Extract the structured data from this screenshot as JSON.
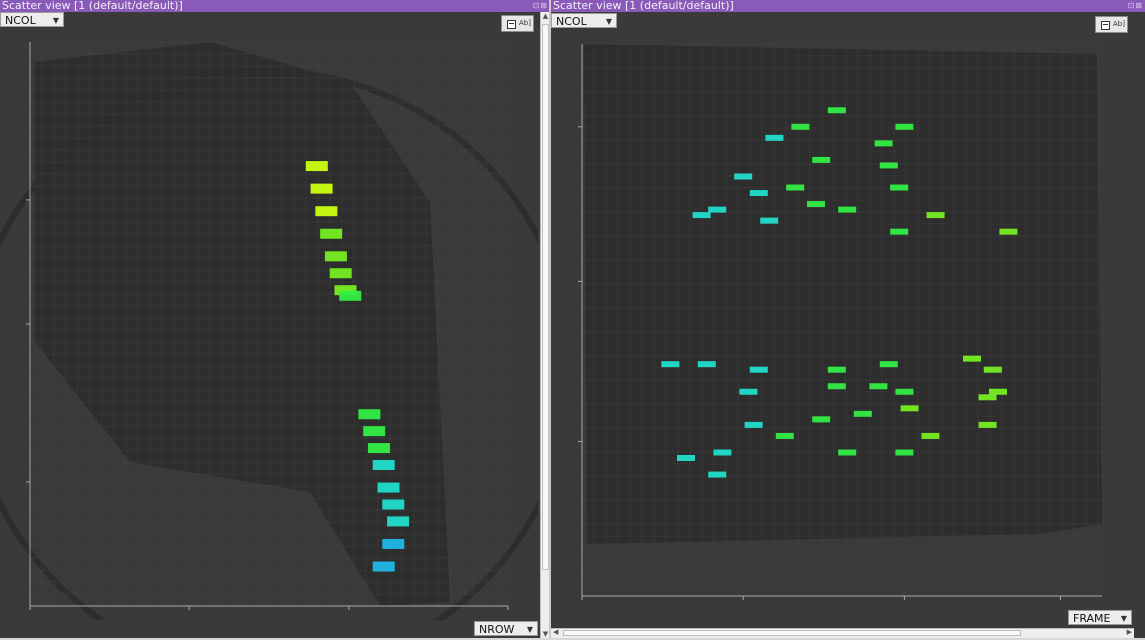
{
  "left_view": {
    "title": "Scatter view [1 (default/default)]",
    "y_selector": "NCOL",
    "x_selector": "NROW",
    "view_button": {
      "icon": "view-options-icon",
      "label": "Ab]"
    }
  },
  "right_view": {
    "title": "Scatter view [1 (default/default)]",
    "y_selector": "NCOL",
    "x_selector": "FRAME",
    "view_button": {
      "icon": "view-options-icon",
      "label": "Ab]"
    }
  },
  "colors": {
    "panel_bg": "#3a3a3a",
    "plot_bg": "#4b4b4b",
    "point_density": "#2d2d2d",
    "title_bar": "#8a5ab8",
    "color_scale": [
      "#1fb8e8",
      "#22ddcc",
      "#33ee44",
      "#77ee22",
      "#ccff11"
    ]
  },
  "chart_data": [
    {
      "type": "scatter",
      "title": "",
      "xlabel": "NROW",
      "ylabel": "NCOL",
      "grid": true,
      "xlim": [
        0,
        1
      ],
      "ylim": [
        0,
        1
      ],
      "legend": "none",
      "series": [
        {
          "values": [
            {
              "x": 0.6,
              "y": 0.78
            },
            {
              "x": 0.61,
              "y": 0.74
            },
            {
              "x": 0.62,
              "y": 0.7
            },
            {
              "x": 0.63,
              "y": 0.66
            },
            {
              "x": 0.64,
              "y": 0.62
            },
            {
              "x": 0.65,
              "y": 0.59
            },
            {
              "x": 0.66,
              "y": 0.56
            },
            {
              "x": 0.67,
              "y": 0.55
            },
            {
              "x": 0.71,
              "y": 0.34
            },
            {
              "x": 0.72,
              "y": 0.31
            },
            {
              "x": 0.73,
              "y": 0.28
            },
            {
              "x": 0.74,
              "y": 0.25
            },
            {
              "x": 0.75,
              "y": 0.21
            },
            {
              "x": 0.76,
              "y": 0.18
            },
            {
              "x": 0.77,
              "y": 0.15
            },
            {
              "x": 0.76,
              "y": 0.11
            },
            {
              "x": 0.74,
              "y": 0.07
            }
          ]
        }
      ]
    },
    {
      "type": "scatter",
      "title": "",
      "xlabel": "FRAME",
      "ylabel": "NCOL",
      "grid": true,
      "xlim": [
        0,
        1
      ],
      "ylim": [
        0,
        1
      ],
      "legend": "none",
      "series": [
        {
          "values": [
            {
              "x": 0.49,
              "y": 0.88
            },
            {
              "x": 0.62,
              "y": 0.85
            },
            {
              "x": 0.58,
              "y": 0.82
            },
            {
              "x": 0.42,
              "y": 0.85
            },
            {
              "x": 0.37,
              "y": 0.83
            },
            {
              "x": 0.46,
              "y": 0.79
            },
            {
              "x": 0.59,
              "y": 0.78
            },
            {
              "x": 0.31,
              "y": 0.76
            },
            {
              "x": 0.34,
              "y": 0.73
            },
            {
              "x": 0.41,
              "y": 0.74
            },
            {
              "x": 0.45,
              "y": 0.71
            },
            {
              "x": 0.61,
              "y": 0.74
            },
            {
              "x": 0.26,
              "y": 0.7
            },
            {
              "x": 0.23,
              "y": 0.69
            },
            {
              "x": 0.36,
              "y": 0.68
            },
            {
              "x": 0.51,
              "y": 0.7
            },
            {
              "x": 0.68,
              "y": 0.69
            },
            {
              "x": 0.61,
              "y": 0.66
            },
            {
              "x": 0.82,
              "y": 0.66
            },
            {
              "x": 0.17,
              "y": 0.42
            },
            {
              "x": 0.24,
              "y": 0.42
            },
            {
              "x": 0.34,
              "y": 0.41
            },
            {
              "x": 0.49,
              "y": 0.41
            },
            {
              "x": 0.59,
              "y": 0.42
            },
            {
              "x": 0.75,
              "y": 0.43
            },
            {
              "x": 0.79,
              "y": 0.41
            },
            {
              "x": 0.32,
              "y": 0.37
            },
            {
              "x": 0.49,
              "y": 0.38
            },
            {
              "x": 0.57,
              "y": 0.38
            },
            {
              "x": 0.62,
              "y": 0.37
            },
            {
              "x": 0.78,
              "y": 0.36
            },
            {
              "x": 0.8,
              "y": 0.37
            },
            {
              "x": 0.46,
              "y": 0.32
            },
            {
              "x": 0.54,
              "y": 0.33
            },
            {
              "x": 0.63,
              "y": 0.34
            },
            {
              "x": 0.33,
              "y": 0.31
            },
            {
              "x": 0.39,
              "y": 0.29
            },
            {
              "x": 0.67,
              "y": 0.29
            },
            {
              "x": 0.78,
              "y": 0.31
            },
            {
              "x": 0.27,
              "y": 0.26
            },
            {
              "x": 0.2,
              "y": 0.25
            },
            {
              "x": 0.51,
              "y": 0.26
            },
            {
              "x": 0.62,
              "y": 0.26
            },
            {
              "x": 0.26,
              "y": 0.22
            }
          ]
        }
      ]
    }
  ]
}
